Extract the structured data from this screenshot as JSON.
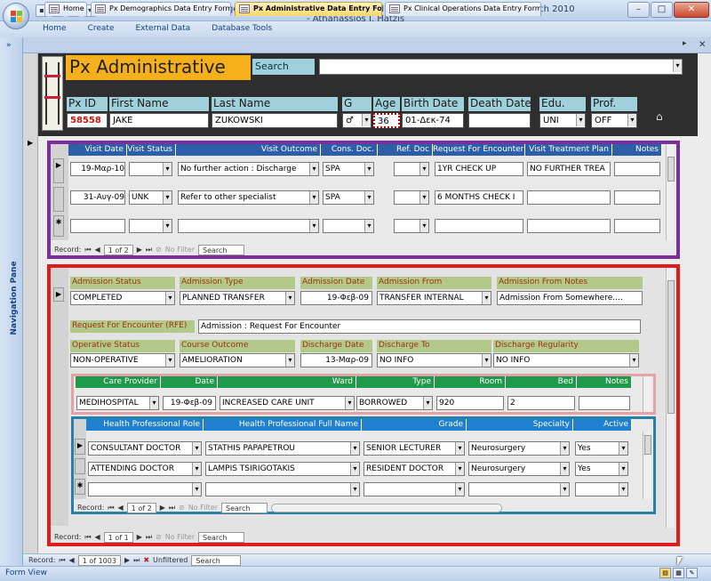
{
  "window": {
    "title": "MEDILIGFE Neurosurgery : Medical Life Guard Front End for Neurosurgeons - v1.0 - (C) March 2010 - Athanassios I. Hatzis",
    "minimize": "–",
    "maximize": "□",
    "close": "✕"
  },
  "ribbon": {
    "tabs": [
      "Home",
      "Create",
      "External Data",
      "Database Tools"
    ]
  },
  "nav_pane": {
    "label": "Navigation Pane",
    "toggle": "»"
  },
  "doc_tabs": [
    "Home",
    "Px Demographics Data Entry Form",
    "Px Administrative Data Entry Form",
    "Px Clinical Operations Data Entry Form"
  ],
  "header": {
    "title": "Px Administrative",
    "search_label": "Search",
    "search_value": "",
    "labels": {
      "px_id": "Px ID",
      "first_name": "First Name",
      "last_name": "Last Name",
      "g": "G",
      "age": "Age",
      "birth_date": "Birth Date",
      "death_date": "Death Date",
      "edu": "Edu.",
      "prof": "Prof."
    },
    "values": {
      "px_id": "58558",
      "first_name": "JAKE",
      "last_name": "ZUKOWSKI",
      "g": "♂",
      "age": "36",
      "birth_date": "01-Δεκ-74",
      "death_date": "",
      "edu": "UNI",
      "prof": "OFF"
    },
    "home_icon": "⌂"
  },
  "visits": {
    "columns": [
      "Visit Date",
      "Visit Status",
      "Visit Outcome",
      "Cons. Doc.",
      "Ref. Doc",
      "Request For Encounter",
      "Visit Treatment Plan",
      "Notes"
    ],
    "rows": [
      [
        "19-Μαρ-10",
        "",
        "No further action : Discharge",
        "SPA",
        "",
        "1YR CHECK UP",
        "NO FURTHER TREA",
        ""
      ],
      [
        "31-Αυγ-09",
        "UNK",
        "Refer to other specialist",
        "SPA",
        "",
        "6 MONTHS CHECK I",
        "",
        ""
      ]
    ],
    "record_label": "Record:",
    "record_pos": "1 of 2",
    "filter": "No Filter",
    "search": "Search"
  },
  "admission": {
    "labels": {
      "status": "Admission Status",
      "type": "Admission Type",
      "date": "Admission Date",
      "from": "Admission From",
      "from_notes": "Admission From Notes",
      "rfe": "Request For Encounter (RFE)",
      "operative": "Operative Status",
      "course": "Course Outcome",
      "discharge_date": "Discharge Date",
      "discharge_to": "Discharge To",
      "regularity": "Discharge Regularity"
    },
    "values": {
      "status": "COMPLETED",
      "type": "PLANNED TRANSFER",
      "date": "19-Φεβ-09",
      "from": "TRANSFER INTERNAL",
      "from_notes": "Admission From Somewhere....",
      "rfe": "Admission : Request For Encounter",
      "operative": "NON-OPERATIVE",
      "course": "AMELIORATION",
      "discharge_date": "13-Μαρ-09",
      "discharge_to": "NO INFO",
      "regularity": "NO INFO"
    },
    "record_label": "Record:",
    "record_pos": "1 of 1",
    "filter": "No Filter",
    "search": "Search"
  },
  "care": {
    "columns": [
      "Care Provider",
      "Date",
      "Ward",
      "Type",
      "Room",
      "Bed",
      "Notes"
    ],
    "row": [
      "MEDIHOSPITAL",
      "19-Φεβ-09",
      "INCREASED CARE UNIT",
      "BORROWED",
      "920",
      "2",
      ""
    ]
  },
  "hp": {
    "columns": [
      "Health Professional Role",
      "Health Professional Full Name",
      "Grade",
      "Specialty",
      "Active"
    ],
    "rows": [
      [
        "CONSULTANT DOCTOR",
        "STATHIS PAPAPETROU",
        "SENIOR LECTURER",
        "Neurosurgery",
        "Yes"
      ],
      [
        "ATTENDING DOCTOR",
        "LAMPIS TSIRIGOTAKIS",
        "RESIDENT DOCTOR",
        "Neurosurgery",
        "Yes"
      ]
    ],
    "record_label": "Record:",
    "record_pos": "1 of 2",
    "filter": "No Filter",
    "search": "Search"
  },
  "main_record": {
    "label": "Record:",
    "pos": "1 of 1003",
    "filter": "Unfiltered",
    "search": "Search"
  },
  "status": "Form View"
}
